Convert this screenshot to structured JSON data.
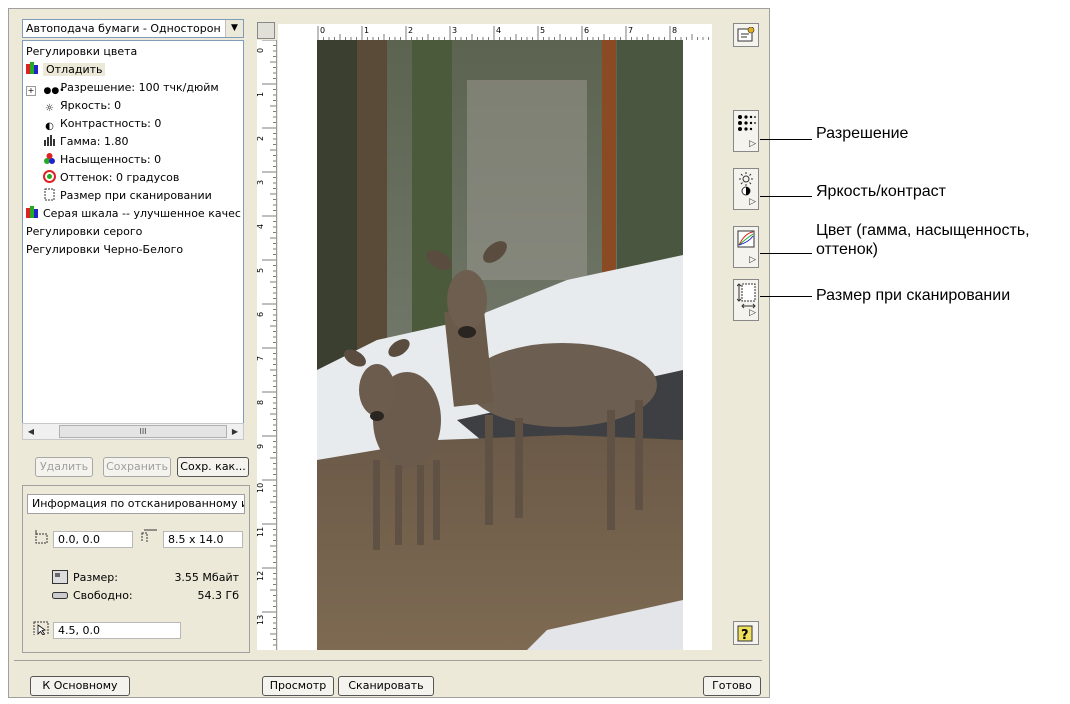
{
  "source_combo": {
    "value": "Автоподача бумаги - Односторон"
  },
  "tree": {
    "items": [
      {
        "label": "Регулировки цвета",
        "level": 0,
        "icon": ""
      },
      {
        "label": "Отладить",
        "level": 0,
        "icon": "color-profile-icon"
      },
      {
        "label": "Разрешение: 100 тчк/дюйм",
        "level": 1,
        "icon": "resolution-dots-icon"
      },
      {
        "label": "Яркость: 0",
        "level": 1,
        "icon": "sun-icon"
      },
      {
        "label": "Контрастность: 0",
        "level": 1,
        "icon": "contrast-icon"
      },
      {
        "label": "Гамма: 1.80",
        "level": 1,
        "icon": "gamma-icon"
      },
      {
        "label": "Насыщенность: 0",
        "level": 1,
        "icon": "saturation-icon"
      },
      {
        "label": "Оттенок: 0 градусов",
        "level": 1,
        "icon": "hue-icon"
      },
      {
        "label": "Размер при сканировании",
        "level": 1,
        "icon": "scan-size-icon"
      },
      {
        "label": "Серая шкала -- улучшенное качес",
        "level": 0,
        "icon": "grayscale-profile-icon"
      },
      {
        "label": "Регулировки серого",
        "level": 0,
        "icon": ""
      },
      {
        "label": "Регулировки Черно-Белого",
        "level": 0,
        "icon": ""
      }
    ],
    "scroll_thumb_text": "III"
  },
  "buttons": {
    "delete": "Удалить",
    "save": "Сохранить",
    "save_as": "Сохр. как...",
    "to_basic": "К Основному",
    "preview": "Просмотр",
    "scan": "Сканировать",
    "done": "Готово"
  },
  "info": {
    "header": "Информация по отсканированному из",
    "origin": "0.0, 0.0",
    "page_size": "8.5 x 14.0",
    "size_label": "Размер:",
    "size_value": "3.55 Мбайт",
    "free_label": "Свободно:",
    "free_value": "54.3 Гб",
    "cursor": "4.5, 0.0"
  },
  "rulers": {
    "top": [
      "0",
      "1",
      "2",
      "3",
      "4",
      "5",
      "6",
      "7",
      "8"
    ],
    "left": [
      "0",
      "1",
      "2",
      "3",
      "4",
      "5",
      "6",
      "7",
      "8",
      "9",
      "10",
      "11",
      "12",
      "13"
    ]
  },
  "callouts": {
    "resolution": "Разрешение",
    "brightness": "Яркость/контраст",
    "color_line1": "Цвет (гамма, насыщенность,",
    "color_line2": "оттенок)",
    "scan_size": "Размер при сканировании"
  },
  "colors": {
    "window_bg": "#ece9d8",
    "accent_border": "#7f9db9"
  }
}
